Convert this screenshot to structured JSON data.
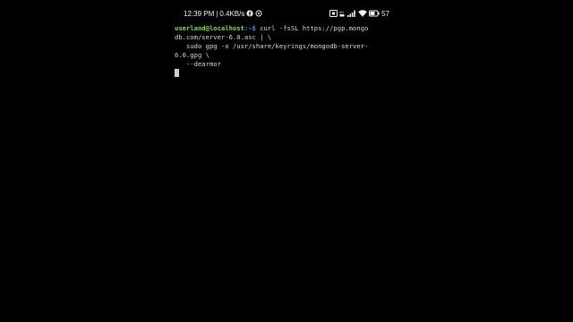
{
  "status_bar": {
    "time": "12:39 PM",
    "separator": "|",
    "network_speed": "0.4KB/s",
    "battery_percent": "57",
    "left_icons": [
      "facebook-icon",
      "sync-icon"
    ],
    "right_icons": [
      "vibrate-icon",
      "hd-volte-icon",
      "signal-icon",
      "wifi-icon",
      "battery-icon"
    ]
  },
  "terminal": {
    "prompt_user": "userland@localhost",
    "prompt_path": ":~$",
    "lines": [
      " curl -fsSL https://pgp.mongo",
      "db.com/server-6.0.asc | \\",
      "   sudo gpg -o /usr/share/keyrings/mongodb-server-",
      "6.0.gpg \\",
      "   --dearmor"
    ]
  },
  "colors": {
    "background": "#000000",
    "prompt_user": "#7ee03a",
    "prompt_path": "#5b8cff",
    "text": "#d8d8d8"
  }
}
